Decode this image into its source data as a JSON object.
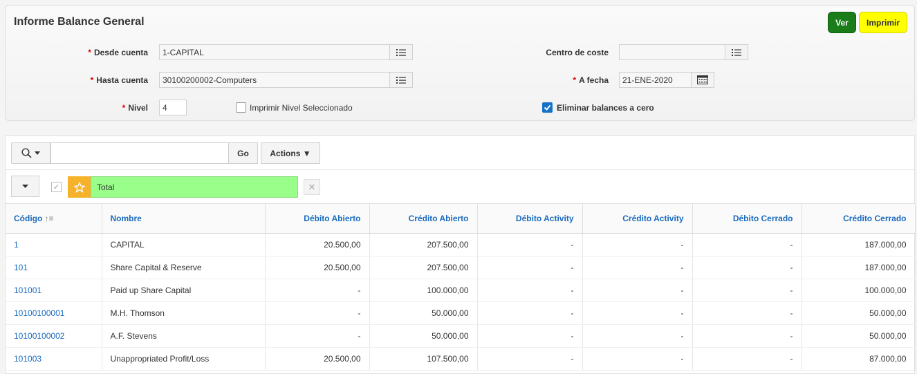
{
  "form": {
    "title": "Informe Balance General",
    "ver_label": "Ver",
    "imprimir_label": "Imprimir",
    "desde_label": "Desde cuenta",
    "desde_value": "1-CAPITAL",
    "hasta_label": "Hasta cuenta",
    "hasta_value": "30100200002-Computers",
    "nivel_label": "Nivel",
    "nivel_value": "4",
    "imprimir_nivel_label": "Imprimir Nivel Seleccionado",
    "centro_label": "Centro de coste",
    "centro_value": "",
    "fecha_label": "A fecha",
    "fecha_value": "21-ENE-2020",
    "eliminar_label": "Eliminar balances a cero",
    "required_mark": "*"
  },
  "toolbar": {
    "go_label": "Go",
    "actions_label": "Actions",
    "search_placeholder": ""
  },
  "filter": {
    "total_label": "Total"
  },
  "table": {
    "headers": [
      "Código",
      "Nombre",
      "Débito Abierto",
      "Crédito Abierto",
      "Débito Activity",
      "Crédito Activity",
      "Débito Cerrado",
      "Crédito Cerrado"
    ],
    "rows": [
      [
        "1",
        "CAPITAL",
        "20.500,00",
        "207.500,00",
        "-",
        "-",
        "-",
        "187.000,00"
      ],
      [
        "101",
        "Share Capital & Reserve",
        "20.500,00",
        "207.500,00",
        "-",
        "-",
        "-",
        "187.000,00"
      ],
      [
        "101001",
        "Paid up Share Capital",
        "-",
        "100.000,00",
        "-",
        "-",
        "-",
        "100.000,00"
      ],
      [
        "10100100001",
        "M.H. Thomson",
        "-",
        "50.000,00",
        "-",
        "-",
        "-",
        "50.000,00"
      ],
      [
        "10100100002",
        "A.F. Stevens",
        "-",
        "50.000,00",
        "-",
        "-",
        "-",
        "50.000,00"
      ],
      [
        "101003",
        "Unappropriated Profit/Loss",
        "20.500,00",
        "107.500,00",
        "-",
        "-",
        "-",
        "87.000,00"
      ]
    ]
  },
  "colors": {
    "accent": "#1a6bbf",
    "ver": "#1a7d1a",
    "imprimir": "#ffff00",
    "total": "#99ff8a",
    "star": "#f7b22c"
  }
}
